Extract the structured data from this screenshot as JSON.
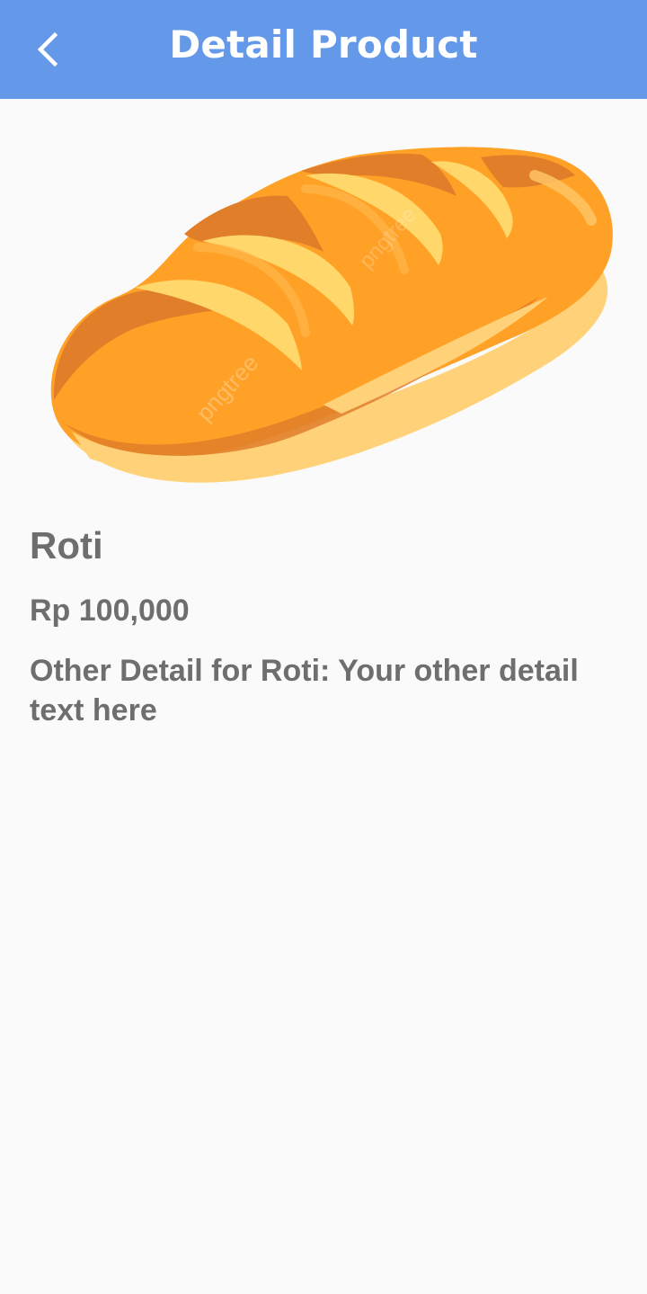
{
  "app_bar": {
    "title": "Detail Product",
    "back_icon": "chevron-left-icon",
    "background_color": "#6499e9"
  },
  "product": {
    "image_icon": "bread-loaf-image",
    "watermark": "pngtree",
    "name": "Roti",
    "price": "Rp 100,000",
    "detail": "Other Detail for Roti: Your other detail text here",
    "text_color": "#6e6e6e"
  }
}
